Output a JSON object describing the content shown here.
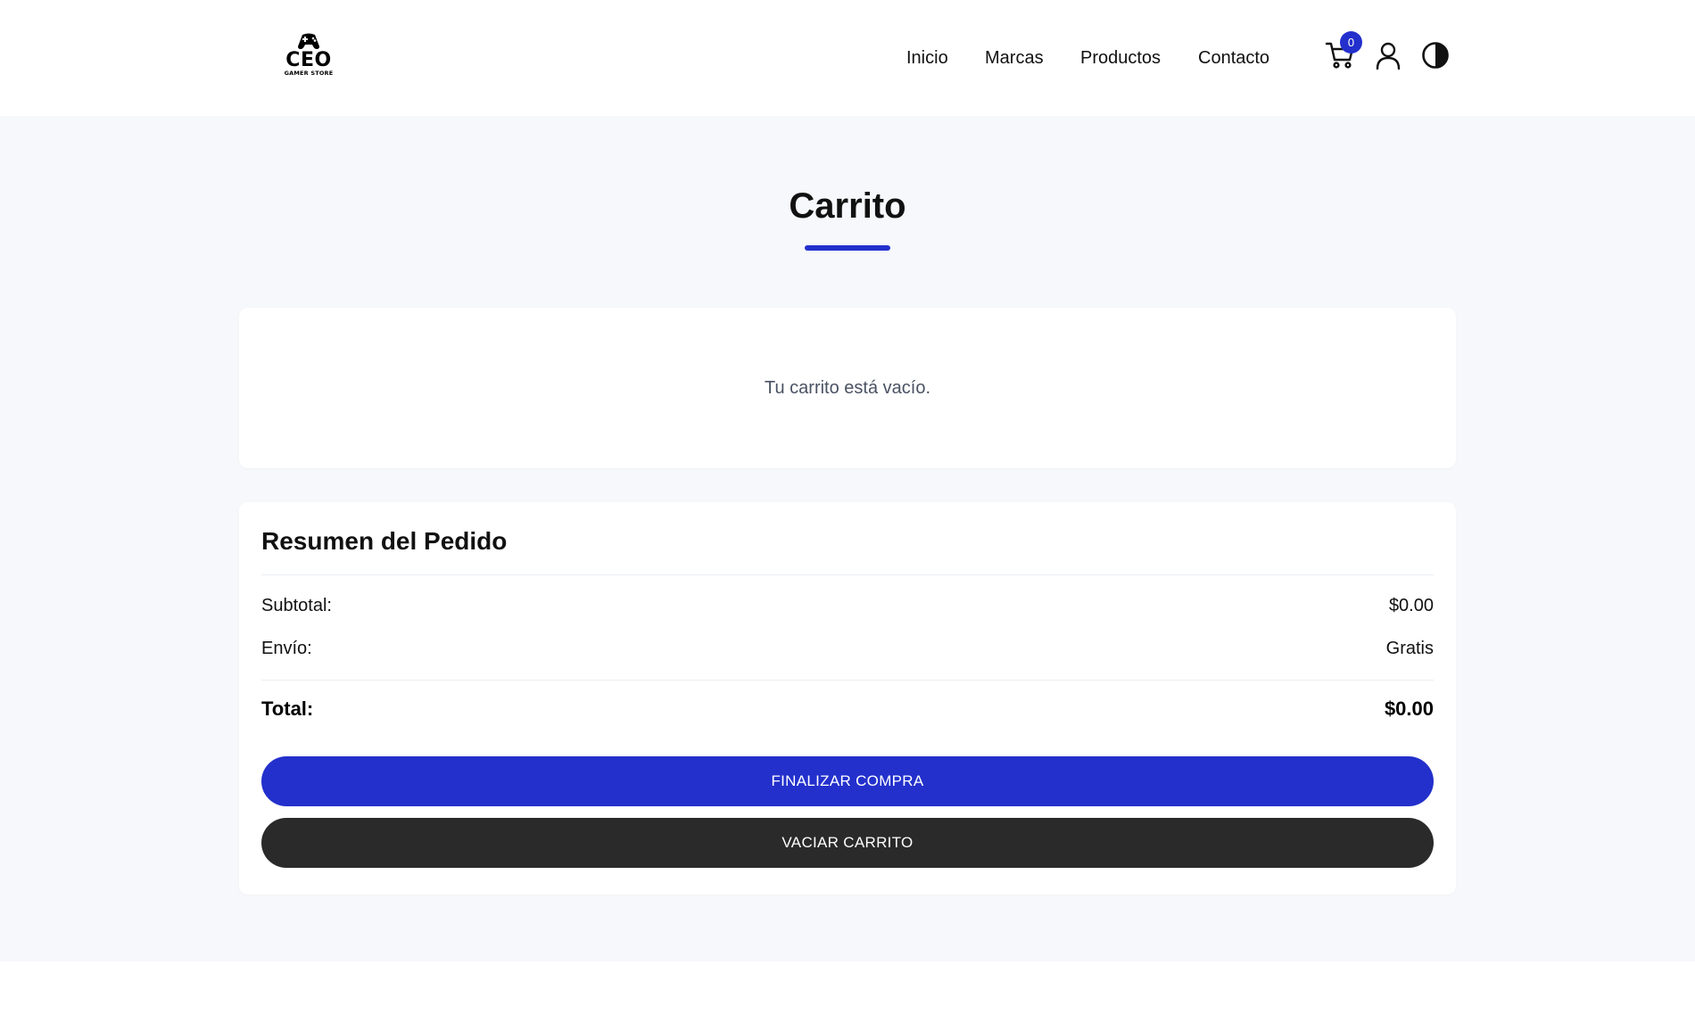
{
  "header": {
    "logo": {
      "main_text": "CEO",
      "sub_text": "GAMER STORE",
      "icon": "gamepad-icon"
    },
    "nav": [
      {
        "label": "Inicio"
      },
      {
        "label": "Marcas"
      },
      {
        "label": "Productos"
      },
      {
        "label": "Contacto"
      }
    ],
    "cart": {
      "icon": "cart-icon",
      "count": "0"
    },
    "user": {
      "icon": "user-icon"
    },
    "theme_toggle": {
      "icon": "contrast-icon"
    }
  },
  "main": {
    "title": "Carrito",
    "empty_message": "Tu carrito está vacío.",
    "summary": {
      "title": "Resumen del Pedido",
      "subtotal_label": "Subtotal:",
      "subtotal_value": "$0.00",
      "shipping_label": "Envío:",
      "shipping_value": "Gratis",
      "total_label": "Total:",
      "total_value": "$0.00",
      "checkout_button": "FINALIZAR COMPRA",
      "clear_button": "VACIAR CARRITO"
    }
  },
  "colors": {
    "accent": "#2330cc",
    "dark_button": "#2a2a2a",
    "page_background": "#f7f8fb",
    "muted_text": "#4a5263"
  }
}
